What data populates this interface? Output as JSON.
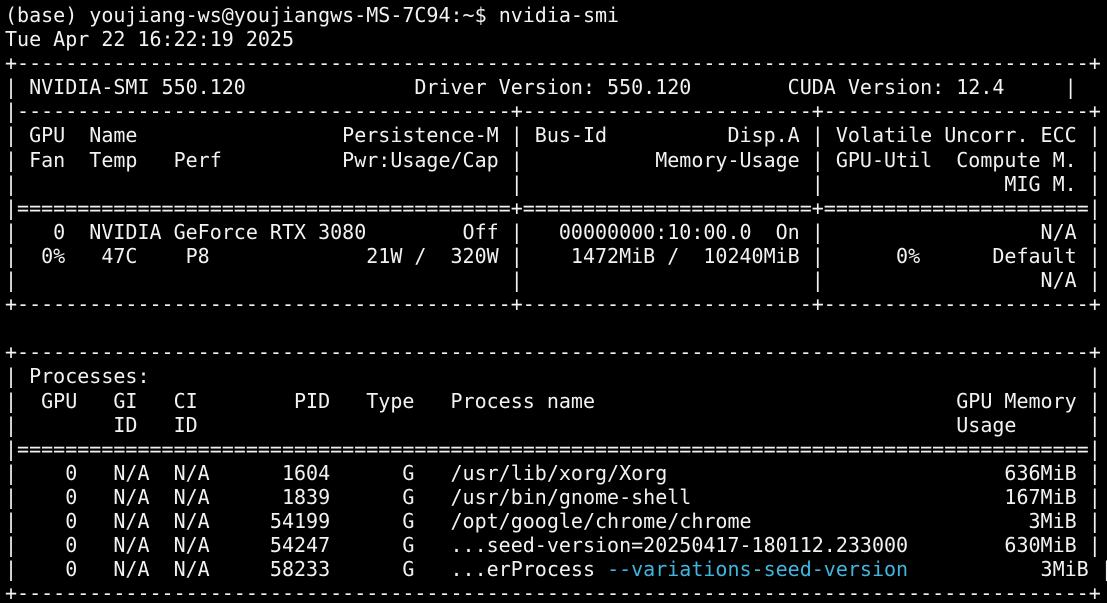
{
  "terminal": {
    "prompt": "(base) youjiang-ws@youjiangws-MS-7C94:~$ ",
    "command": "nvidia-smi",
    "timestamp": "Tue Apr 22 16:22:19 2025"
  },
  "lines": [
    {
      "text": "+-----------------------------------------------------------------------------------------+",
      "hl": ""
    },
    {
      "text": "| NVIDIA-SMI 550.120              Driver Version: 550.120        CUDA Version: 12.4     |",
      "hl": ""
    },
    {
      "text": "|-----------------------------------------+------------------------+----------------------+",
      "hl": ""
    },
    {
      "text": "| GPU  Name                 Persistence-M | Bus-Id          Disp.A | Volatile Uncorr. ECC |",
      "hl": ""
    },
    {
      "text": "| Fan  Temp   Perf          Pwr:Usage/Cap |           Memory-Usage | GPU-Util  Compute M. |",
      "hl": ""
    },
    {
      "text": "|                                         |                        |               MIG M. |",
      "hl": ""
    },
    {
      "text": "|=========================================+========================+======================|",
      "hl": ""
    },
    {
      "text": "|   0  NVIDIA GeForce RTX 3080        Off |   00000000:10:00.0  On |                  N/A |",
      "hl": ""
    },
    {
      "text": "|  0%   47C    P8             21W /  320W |    1472MiB /  10240MiB |      0%      Default |",
      "hl": ""
    },
    {
      "text": "|                                         |                        |                  N/A |",
      "hl": ""
    },
    {
      "text": "+-----------------------------------------+------------------------+----------------------+",
      "hl": ""
    },
    {
      "text": "",
      "hl": ""
    },
    {
      "text": "+-----------------------------------------------------------------------------------------+",
      "hl": ""
    },
    {
      "text": "| Processes:                                                                              |",
      "hl": ""
    },
    {
      "text": "|  GPU   GI   CI        PID   Type   Process name                              GPU Memory |",
      "hl": ""
    },
    {
      "text": "|        ID   ID                                                               Usage      |",
      "hl": ""
    },
    {
      "text": "|=========================================================================================|",
      "hl": ""
    },
    {
      "text": "|    0   N/A  N/A      1604      G   /usr/lib/xorg/Xorg                            636MiB |",
      "hl": ""
    },
    {
      "text": "|    0   N/A  N/A      1839      G   /usr/bin/gnome-shell                          167MiB |",
      "hl": ""
    },
    {
      "text": "|    0   N/A  N/A     54199      G   /opt/google/chrome/chrome                       3MiB |",
      "hl": ""
    },
    {
      "text": "|    0   N/A  N/A     54247      G   ...seed-version=20250417-180112.233000        630MiB |",
      "hl": ""
    },
    {
      "text": "|    0   N/A  N/A     58233      G   ...erProcess ",
      "hl": "--variations-seed-version",
      "tail": "           3MiB |"
    },
    {
      "text": "+-----------------------------------------------------------------------------------------+",
      "hl": ""
    }
  ]
}
